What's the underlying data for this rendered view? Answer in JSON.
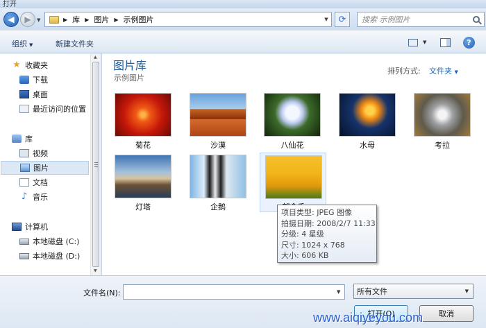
{
  "window": {
    "title": "打开"
  },
  "nav": {
    "breadcrumbs": [
      "库",
      "图片",
      "示例图片"
    ],
    "search_placeholder": "搜索 示例图片"
  },
  "toolbar": {
    "organize": "组织",
    "new_folder": "新建文件夹"
  },
  "sidebar": {
    "favorites": {
      "label": "收藏夹",
      "items": [
        "下载",
        "桌面",
        "最近访问的位置"
      ]
    },
    "libraries": {
      "label": "库",
      "items": [
        "视频",
        "图片",
        "文档",
        "音乐"
      ],
      "selected": "图片"
    },
    "computer": {
      "label": "计算机",
      "items": [
        "本地磁盘 (C:)",
        "本地磁盘 (D:)"
      ]
    }
  },
  "content": {
    "title": "图片库",
    "subtitle": "示例图片",
    "sort_label": "排列方式:",
    "sort_value": "文件夹",
    "files": [
      {
        "name": "菊花"
      },
      {
        "name": "沙漠"
      },
      {
        "name": "八仙花"
      },
      {
        "name": "水母"
      },
      {
        "name": "考拉"
      },
      {
        "name": "灯塔"
      },
      {
        "name": "企鹅"
      },
      {
        "name": "郁金香"
      }
    ]
  },
  "tooltip": {
    "type": "项目类型: JPEG 图像",
    "date": "拍摄日期: 2008/2/7 11:33",
    "rating": "分级: 4 星级",
    "size_px": "尺寸: 1024 x 768",
    "size_kb": "大小: 606 KB"
  },
  "bottom": {
    "filename_label": "文件名(N):",
    "filename_value": "",
    "filter": "所有文件",
    "open": "打开(O)",
    "cancel": "取消"
  },
  "watermark": "www.aiqiyeyou.com",
  "colors": {
    "accent": "#1e5d9a",
    "link": "#1a63b8",
    "chrome": "#dde7f3"
  }
}
